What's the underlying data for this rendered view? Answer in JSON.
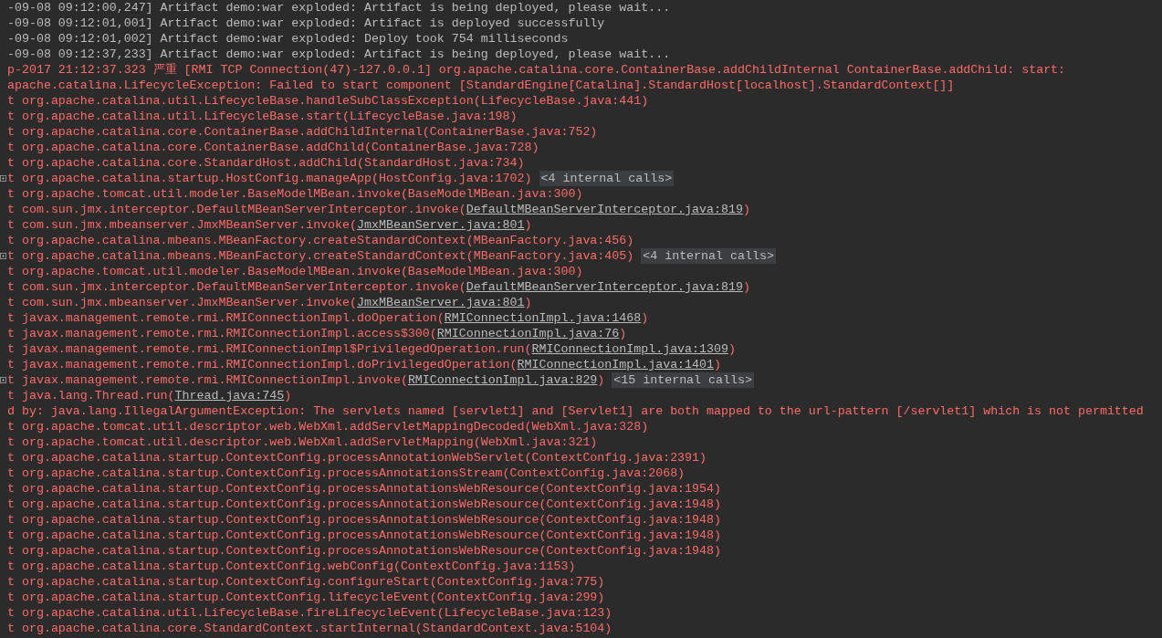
{
  "console": {
    "lines": [
      {
        "kind": "info",
        "foldable": false,
        "parts": [
          {
            "text": "-09-08 09:12:00,247] Artifact demo:war exploded: Artifact is being deployed, please wait...",
            "link": false
          }
        ]
      },
      {
        "kind": "info",
        "foldable": false,
        "parts": [
          {
            "text": "-09-08 09:12:01,001] Artifact demo:war exploded: Artifact is deployed successfully",
            "link": false
          }
        ]
      },
      {
        "kind": "info",
        "foldable": false,
        "parts": [
          {
            "text": "-09-08 09:12:01,002] Artifact demo:war exploded: Deploy took 754 milliseconds",
            "link": false
          }
        ]
      },
      {
        "kind": "info",
        "foldable": false,
        "parts": [
          {
            "text": "-09-08 09:12:37,233] Artifact demo:war exploded: Artifact is being deployed, please wait...",
            "link": false
          }
        ]
      },
      {
        "kind": "error",
        "foldable": false,
        "parts": [
          {
            "text": "p-2017 21:12:37.323 严重 [RMI TCP Connection(47)-127.0.0.1] org.apache.catalina.core.ContainerBase.addChildInternal ContainerBase.addChild: start:",
            "link": false
          }
        ]
      },
      {
        "kind": "error",
        "foldable": false,
        "parts": [
          {
            "text": "apache.catalina.LifecycleException: Failed to start component [StandardEngine[Catalina].StandardHost[localhost].StandardContext[]]",
            "link": false
          }
        ]
      },
      {
        "kind": "error",
        "foldable": false,
        "parts": [
          {
            "text": "t org.apache.catalina.util.LifecycleBase.handleSubClassException(LifecycleBase.java:441)",
            "link": false
          }
        ]
      },
      {
        "kind": "error",
        "foldable": false,
        "parts": [
          {
            "text": "t org.apache.catalina.util.LifecycleBase.start(LifecycleBase.java:198)",
            "link": false
          }
        ]
      },
      {
        "kind": "error",
        "foldable": false,
        "parts": [
          {
            "text": "t org.apache.catalina.core.ContainerBase.addChildInternal(ContainerBase.java:752)",
            "link": false
          }
        ]
      },
      {
        "kind": "error",
        "foldable": false,
        "parts": [
          {
            "text": "t org.apache.catalina.core.ContainerBase.addChild(ContainerBase.java:728)",
            "link": false
          }
        ]
      },
      {
        "kind": "error",
        "foldable": false,
        "parts": [
          {
            "text": "t org.apache.catalina.core.StandardHost.addChild(StandardHost.java:734)",
            "link": false
          }
        ]
      },
      {
        "kind": "error",
        "foldable": true,
        "parts": [
          {
            "text": "t org.apache.catalina.startup.HostConfig.manageApp(HostConfig.java:1702)",
            "link": false
          }
        ],
        "badge": "<4 internal calls>"
      },
      {
        "kind": "error",
        "foldable": false,
        "parts": [
          {
            "text": "t org.apache.tomcat.util.modeler.BaseModelMBean.invoke(BaseModelMBean.java:300)",
            "link": false
          }
        ]
      },
      {
        "kind": "error",
        "foldable": false,
        "parts": [
          {
            "text": "t com.sun.jmx.interceptor.DefaultMBeanServerInterceptor.invoke(",
            "link": false
          },
          {
            "text": "DefaultMBeanServerInterceptor.java:819",
            "link": true
          },
          {
            "text": ")",
            "link": false
          }
        ]
      },
      {
        "kind": "error",
        "foldable": false,
        "parts": [
          {
            "text": "t com.sun.jmx.mbeanserver.JmxMBeanServer.invoke(",
            "link": false
          },
          {
            "text": "JmxMBeanServer.java:801",
            "link": true
          },
          {
            "text": ")",
            "link": false
          }
        ]
      },
      {
        "kind": "error",
        "foldable": false,
        "parts": [
          {
            "text": "t org.apache.catalina.mbeans.MBeanFactory.createStandardContext(MBeanFactory.java:456)",
            "link": false
          }
        ]
      },
      {
        "kind": "error",
        "foldable": true,
        "parts": [
          {
            "text": "t org.apache.catalina.mbeans.MBeanFactory.createStandardContext(MBeanFactory.java:405)",
            "link": false
          }
        ],
        "badge": "<4 internal calls>"
      },
      {
        "kind": "error",
        "foldable": false,
        "parts": [
          {
            "text": "t org.apache.tomcat.util.modeler.BaseModelMBean.invoke(BaseModelMBean.java:300)",
            "link": false
          }
        ]
      },
      {
        "kind": "error",
        "foldable": false,
        "parts": [
          {
            "text": "t com.sun.jmx.interceptor.DefaultMBeanServerInterceptor.invoke(",
            "link": false
          },
          {
            "text": "DefaultMBeanServerInterceptor.java:819",
            "link": true
          },
          {
            "text": ")",
            "link": false
          }
        ]
      },
      {
        "kind": "error",
        "foldable": false,
        "parts": [
          {
            "text": "t com.sun.jmx.mbeanserver.JmxMBeanServer.invoke(",
            "link": false
          },
          {
            "text": "JmxMBeanServer.java:801",
            "link": true
          },
          {
            "text": ")",
            "link": false
          }
        ]
      },
      {
        "kind": "error",
        "foldable": false,
        "parts": [
          {
            "text": "t javax.management.remote.rmi.RMIConnectionImpl.doOperation(",
            "link": false
          },
          {
            "text": "RMIConnectionImpl.java:1468",
            "link": true
          },
          {
            "text": ")",
            "link": false
          }
        ]
      },
      {
        "kind": "error",
        "foldable": false,
        "parts": [
          {
            "text": "t javax.management.remote.rmi.RMIConnectionImpl.access$300(",
            "link": false
          },
          {
            "text": "RMIConnectionImpl.java:76",
            "link": true
          },
          {
            "text": ")",
            "link": false
          }
        ]
      },
      {
        "kind": "error",
        "foldable": false,
        "parts": [
          {
            "text": "t javax.management.remote.rmi.RMIConnectionImpl$PrivilegedOperation.run(",
            "link": false
          },
          {
            "text": "RMIConnectionImpl.java:1309",
            "link": true
          },
          {
            "text": ")",
            "link": false
          }
        ]
      },
      {
        "kind": "error",
        "foldable": false,
        "parts": [
          {
            "text": "t javax.management.remote.rmi.RMIConnectionImpl.doPrivilegedOperation(",
            "link": false
          },
          {
            "text": "RMIConnectionImpl.java:1401",
            "link": true
          },
          {
            "text": ")",
            "link": false
          }
        ]
      },
      {
        "kind": "error",
        "foldable": true,
        "parts": [
          {
            "text": "t javax.management.remote.rmi.RMIConnectionImpl.invoke(",
            "link": false
          },
          {
            "text": "RMIConnectionImpl.java:829",
            "link": true
          },
          {
            "text": ")",
            "link": false
          }
        ],
        "badge": "<15 internal calls>"
      },
      {
        "kind": "error",
        "foldable": false,
        "parts": [
          {
            "text": "t java.lang.Thread.run(",
            "link": false
          },
          {
            "text": "Thread.java:745",
            "link": true
          },
          {
            "text": ")",
            "link": false
          }
        ]
      },
      {
        "kind": "error",
        "foldable": false,
        "parts": [
          {
            "text": "d by: java.lang.IllegalArgumentException: The servlets named [servlet1] and [Servlet1] are both mapped to the url-pattern [/servlet1] which is not permitted",
            "link": false
          }
        ]
      },
      {
        "kind": "error",
        "foldable": false,
        "parts": [
          {
            "text": "t org.apache.tomcat.util.descriptor.web.WebXml.addServletMappingDecoded(WebXml.java:328)",
            "link": false
          }
        ]
      },
      {
        "kind": "error",
        "foldable": false,
        "parts": [
          {
            "text": "t org.apache.tomcat.util.descriptor.web.WebXml.addServletMapping(WebXml.java:321)",
            "link": false
          }
        ]
      },
      {
        "kind": "error",
        "foldable": false,
        "parts": [
          {
            "text": "t org.apache.catalina.startup.ContextConfig.processAnnotationWebServlet(ContextConfig.java:2391)",
            "link": false
          }
        ]
      },
      {
        "kind": "error",
        "foldable": false,
        "parts": [
          {
            "text": "t org.apache.catalina.startup.ContextConfig.processAnnotationsStream(ContextConfig.java:2068)",
            "link": false
          }
        ]
      },
      {
        "kind": "error",
        "foldable": false,
        "parts": [
          {
            "text": "t org.apache.catalina.startup.ContextConfig.processAnnotationsWebResource(ContextConfig.java:1954)",
            "link": false
          }
        ]
      },
      {
        "kind": "error",
        "foldable": false,
        "parts": [
          {
            "text": "t org.apache.catalina.startup.ContextConfig.processAnnotationsWebResource(ContextConfig.java:1948)",
            "link": false
          }
        ]
      },
      {
        "kind": "error",
        "foldable": false,
        "parts": [
          {
            "text": "t org.apache.catalina.startup.ContextConfig.processAnnotationsWebResource(ContextConfig.java:1948)",
            "link": false
          }
        ]
      },
      {
        "kind": "error",
        "foldable": false,
        "parts": [
          {
            "text": "t org.apache.catalina.startup.ContextConfig.processAnnotationsWebResource(ContextConfig.java:1948)",
            "link": false
          }
        ]
      },
      {
        "kind": "error",
        "foldable": false,
        "parts": [
          {
            "text": "t org.apache.catalina.startup.ContextConfig.processAnnotationsWebResource(ContextConfig.java:1948)",
            "link": false
          }
        ]
      },
      {
        "kind": "error",
        "foldable": false,
        "parts": [
          {
            "text": "t org.apache.catalina.startup.ContextConfig.webConfig(ContextConfig.java:1153)",
            "link": false
          }
        ]
      },
      {
        "kind": "error",
        "foldable": false,
        "parts": [
          {
            "text": "t org.apache.catalina.startup.ContextConfig.configureStart(ContextConfig.java:775)",
            "link": false
          }
        ]
      },
      {
        "kind": "error",
        "foldable": false,
        "parts": [
          {
            "text": "t org.apache.catalina.startup.ContextConfig.lifecycleEvent(ContextConfig.java:299)",
            "link": false
          }
        ]
      },
      {
        "kind": "error",
        "foldable": false,
        "parts": [
          {
            "text": "t org.apache.catalina.util.LifecycleBase.fireLifecycleEvent(LifecycleBase.java:123)",
            "link": false
          }
        ]
      },
      {
        "kind": "error",
        "foldable": false,
        "parts": [
          {
            "text": "t org.apache.catalina.core.StandardContext.startInternal(StandardContext.java:5104)",
            "link": false
          }
        ]
      }
    ]
  }
}
